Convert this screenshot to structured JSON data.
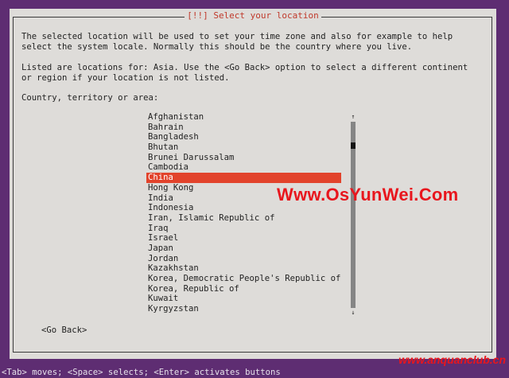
{
  "dialog": {
    "title": "[!!] Select your location",
    "description_line1": "The selected location will be used to set your time zone and also for example to help",
    "description_line2": "select the system locale. Normally this should be the country where you live.",
    "info_line1": "Listed are locations for: Asia. Use the <Go Back> option to select a different continent",
    "info_line2": "or region if your location is not listed.",
    "prompt": "Country, territory or area:",
    "countries": [
      "Afghanistan",
      "Bahrain",
      "Bangladesh",
      "Bhutan",
      "Brunei Darussalam",
      "Cambodia",
      "China",
      "Hong Kong",
      "India",
      "Indonesia",
      "Iran, Islamic Republic of",
      "Iraq",
      "Israel",
      "Japan",
      "Jordan",
      "Kazakhstan",
      "Korea, Democratic People's Republic of",
      "Korea, Republic of",
      "Kuwait",
      "Kyrgyzstan"
    ],
    "selected_country": "China",
    "go_back_label": "<Go Back>",
    "scroll_up_icon": "arrow-up-icon",
    "scroll_down_icon": "arrow-down-icon"
  },
  "watermarks": {
    "main": "Www.OsYunWei.Com",
    "corner": "www.anquanclub.cn"
  },
  "status_bar": {
    "hint": "<Tab> moves; <Space> selects; <Enter> activates buttons"
  },
  "colors": {
    "background": "#5e2d72",
    "dialog": "#dedcd9",
    "selection": "#e2432b",
    "title": "#c0392b",
    "watermark": "#e8161d"
  }
}
